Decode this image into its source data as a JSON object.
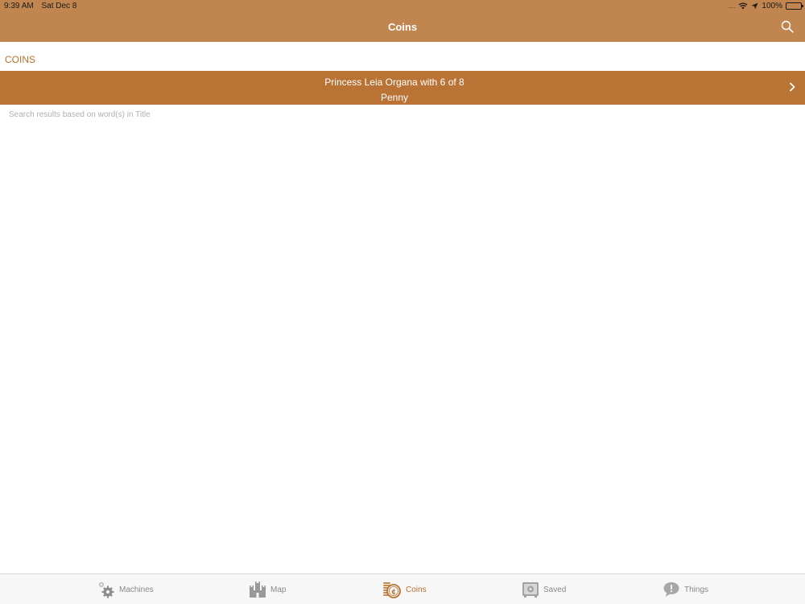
{
  "status_bar": {
    "time": "9:39 AM",
    "date": "Sat Dec 8",
    "signal": "....",
    "battery": "100%"
  },
  "nav": {
    "title": "Coins"
  },
  "section": {
    "header": "COINS"
  },
  "results": [
    {
      "line1": "Princess Leia Organa with 6 of 8",
      "line2": "Penny"
    }
  ],
  "hint": "Search results based on word(s) in Title",
  "tabs": [
    {
      "label": "Machines",
      "icon": "gears-icon",
      "active": false
    },
    {
      "label": "Map",
      "icon": "castle-icon",
      "active": false
    },
    {
      "label": "Coins",
      "icon": "coins-icon",
      "active": true
    },
    {
      "label": "Saved",
      "icon": "safe-icon",
      "active": false
    },
    {
      "label": "Things",
      "icon": "speech-bubble-icon",
      "active": false
    }
  ],
  "colors": {
    "nav_bg": "#c1864f",
    "row_bg": "#b97334",
    "accent": "#b97231",
    "inactive_tab": "#8a8a8a"
  }
}
